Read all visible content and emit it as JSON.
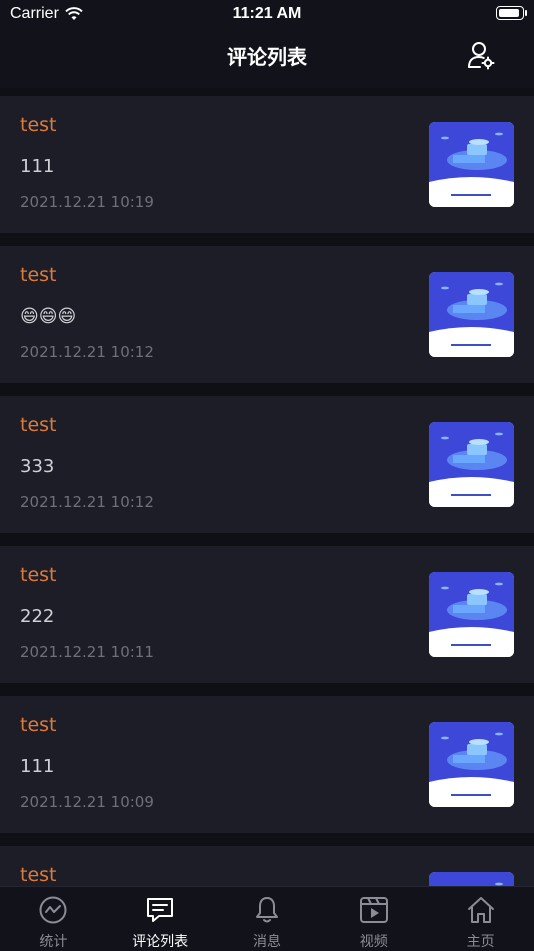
{
  "status": {
    "carrier": "Carrier",
    "time": "11:21 AM"
  },
  "header": {
    "title": "评论列表",
    "settings_icon": "user-settings-icon"
  },
  "comments": [
    {
      "author": "test",
      "text": "111",
      "time": "2021.12.21 10:19"
    },
    {
      "author": "test",
      "text": "😄😄😄",
      "time": "2021.12.21 10:12"
    },
    {
      "author": "test",
      "text": "333",
      "time": "2021.12.21 10:12"
    },
    {
      "author": "test",
      "text": "222",
      "time": "2021.12.21 10:11"
    },
    {
      "author": "test",
      "text": "111",
      "time": "2021.12.21 10:09"
    },
    {
      "author": "test",
      "text": "",
      "time": ""
    }
  ],
  "tabs": [
    {
      "label": "统计",
      "icon": "stats-icon"
    },
    {
      "label": "评论列表",
      "icon": "comment-icon",
      "active": true
    },
    {
      "label": "消息",
      "icon": "bell-icon"
    },
    {
      "label": "视频",
      "icon": "video-icon"
    },
    {
      "label": "主页",
      "icon": "home-icon"
    }
  ],
  "colors": {
    "accent": "#e07a37",
    "background": "#0f1015",
    "card": "#1c1d26"
  }
}
